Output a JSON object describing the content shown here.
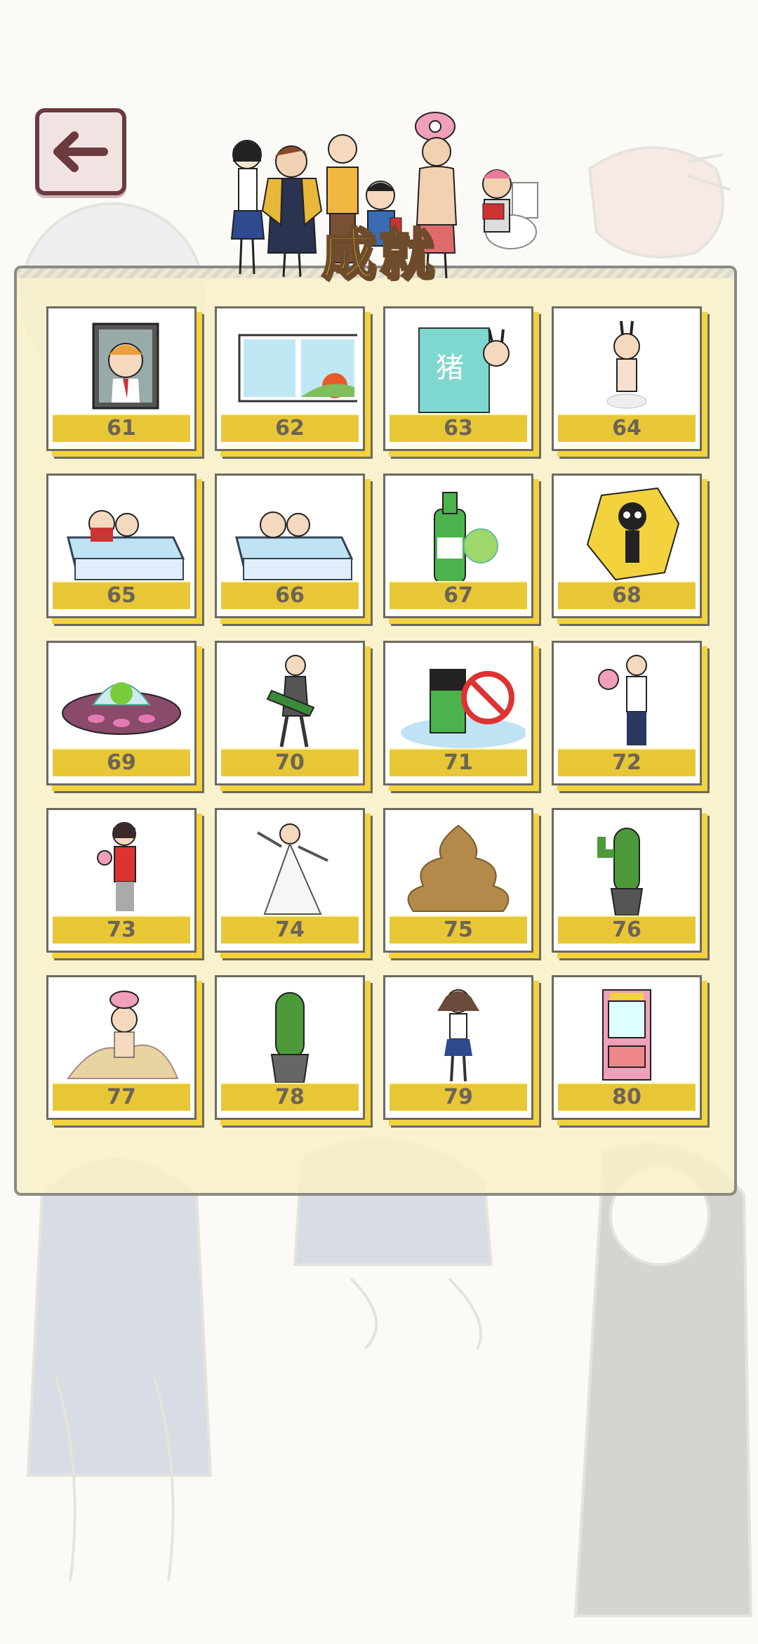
{
  "header": {
    "back_icon": "arrow-left-icon",
    "title": "成就"
  },
  "achievements": [
    {
      "number": "61",
      "icon": "man-in-window-icon"
    },
    {
      "number": "62",
      "icon": "window-sunrise-icon"
    },
    {
      "number": "63",
      "icon": "shower-curtain-icon"
    },
    {
      "number": "64",
      "icon": "bunny-costume-icon"
    },
    {
      "number": "65",
      "icon": "pool-couple-icon"
    },
    {
      "number": "66",
      "icon": "pool-elders-icon"
    },
    {
      "number": "67",
      "icon": "bottle-icon"
    },
    {
      "number": "68",
      "icon": "skeleton-shock-icon"
    },
    {
      "number": "69",
      "icon": "ufo-icon"
    },
    {
      "number": "70",
      "icon": "guitarist-icon"
    },
    {
      "number": "71",
      "icon": "no-battery-icon"
    },
    {
      "number": "72",
      "icon": "man-balloon-icon"
    },
    {
      "number": "73",
      "icon": "girl-red-sweater-icon"
    },
    {
      "number": "74",
      "icon": "dancer-icon"
    },
    {
      "number": "75",
      "icon": "poop-icon"
    },
    {
      "number": "76",
      "icon": "cactus-icon"
    },
    {
      "number": "77",
      "icon": "sand-bury-icon"
    },
    {
      "number": "78",
      "icon": "cactus-pot-icon"
    },
    {
      "number": "79",
      "icon": "schoolgirl-icon"
    },
    {
      "number": "80",
      "icon": "claw-machine-icon"
    }
  ],
  "colors": {
    "card_label": "#e8c737",
    "card_shadow": "#f2d33e",
    "panel": "#f8f0c8",
    "back_border": "#6b3a3e"
  }
}
